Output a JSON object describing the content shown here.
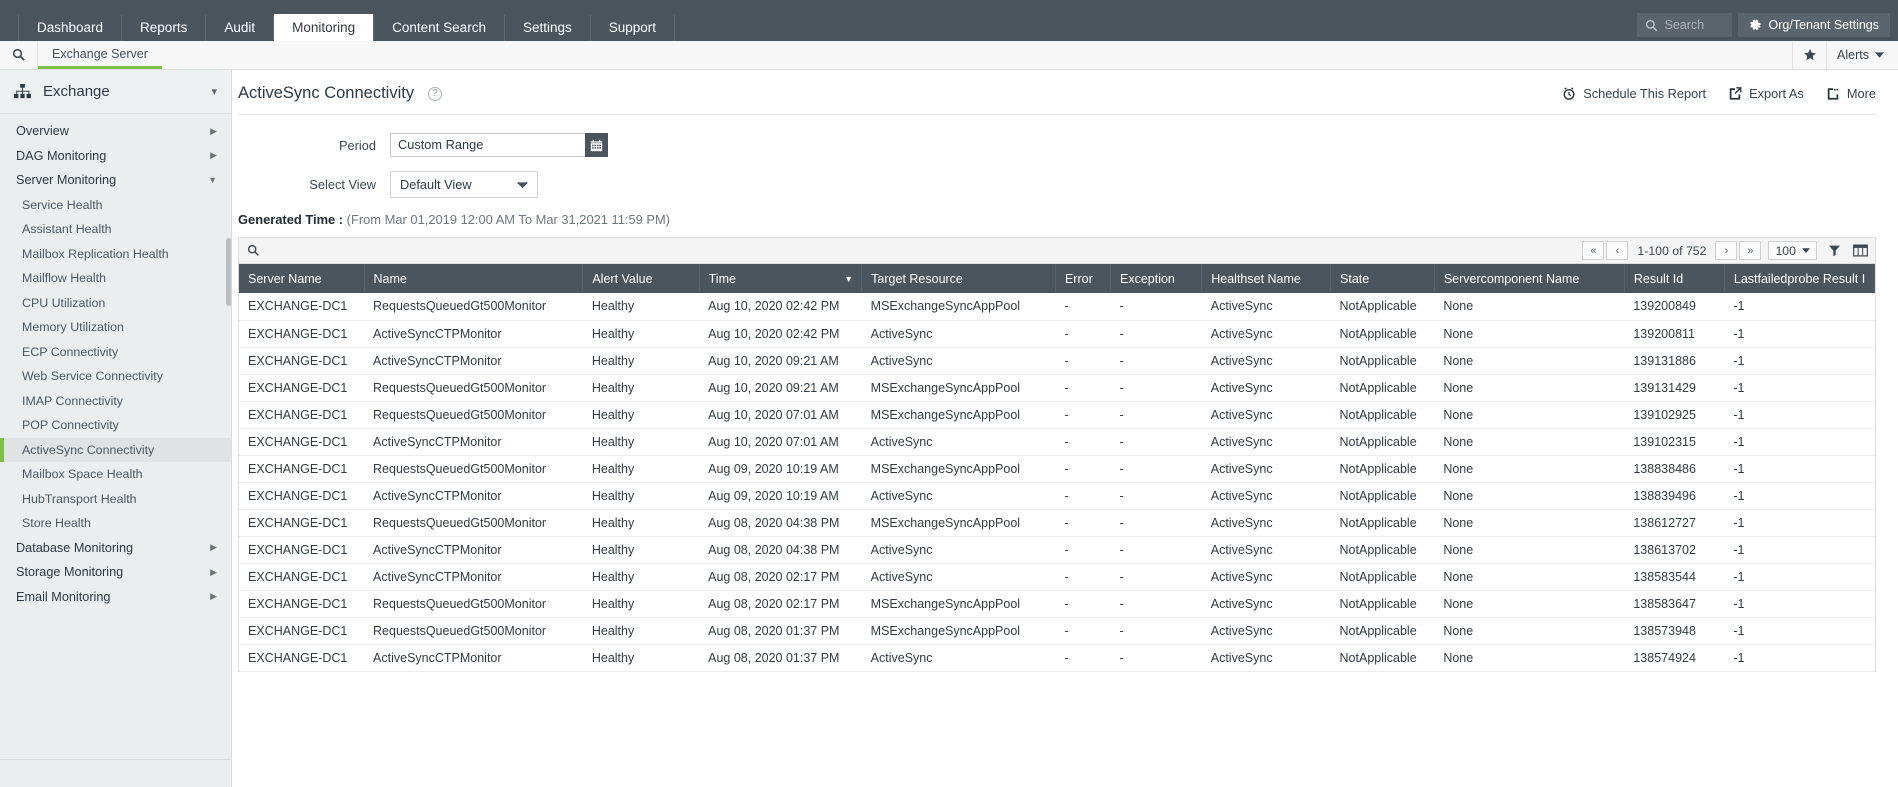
{
  "topnav": {
    "items": [
      {
        "label": "Dashboard",
        "active": false
      },
      {
        "label": "Reports",
        "active": false
      },
      {
        "label": "Audit",
        "active": false
      },
      {
        "label": "Monitoring",
        "active": true
      },
      {
        "label": "Content Search",
        "active": false
      },
      {
        "label": "Settings",
        "active": false
      },
      {
        "label": "Support",
        "active": false
      }
    ],
    "search_placeholder": "Search",
    "org_settings_label": "Org/Tenant Settings"
  },
  "subbar": {
    "tab_label": "Exchange Server",
    "alerts_label": "Alerts",
    "accent_color": "#7cc242"
  },
  "sidebar": {
    "header_title": "Exchange",
    "items": [
      {
        "label": "Overview",
        "level": 0,
        "caret": "▶",
        "selected": false
      },
      {
        "label": "DAG Monitoring",
        "level": 0,
        "caret": "▶",
        "selected": false
      },
      {
        "label": "Server Monitoring",
        "level": 0,
        "caret": "▼",
        "selected": false
      },
      {
        "label": "Service Health",
        "level": 1,
        "caret": "",
        "selected": false
      },
      {
        "label": "Assistant Health",
        "level": 1,
        "caret": "",
        "selected": false
      },
      {
        "label": "Mailbox Replication Health",
        "level": 1,
        "caret": "",
        "selected": false
      },
      {
        "label": "Mailflow Health",
        "level": 1,
        "caret": "",
        "selected": false
      },
      {
        "label": "CPU Utilization",
        "level": 1,
        "caret": "",
        "selected": false
      },
      {
        "label": "Memory Utilization",
        "level": 1,
        "caret": "",
        "selected": false
      },
      {
        "label": "ECP Connectivity",
        "level": 1,
        "caret": "",
        "selected": false
      },
      {
        "label": "Web Service Connectivity",
        "level": 1,
        "caret": "",
        "selected": false
      },
      {
        "label": "IMAP Connectivity",
        "level": 1,
        "caret": "",
        "selected": false
      },
      {
        "label": "POP Connectivity",
        "level": 1,
        "caret": "",
        "selected": false
      },
      {
        "label": "ActiveSync Connectivity",
        "level": 1,
        "caret": "",
        "selected": true
      },
      {
        "label": "Mailbox Space Health",
        "level": 1,
        "caret": "",
        "selected": false
      },
      {
        "label": "HubTransport Health",
        "level": 1,
        "caret": "",
        "selected": false
      },
      {
        "label": "Store Health",
        "level": 1,
        "caret": "",
        "selected": false
      },
      {
        "label": "Database Monitoring",
        "level": 0,
        "caret": "▶",
        "selected": false
      },
      {
        "label": "Storage Monitoring",
        "level": 0,
        "caret": "▶",
        "selected": false
      },
      {
        "label": "Email Monitoring",
        "level": 0,
        "caret": "▶",
        "selected": false
      }
    ]
  },
  "page": {
    "title": "ActiveSync Connectivity",
    "actions": [
      {
        "label": "Schedule This Report",
        "icon": "alarm-clock-icon"
      },
      {
        "label": "Export As",
        "icon": "export-icon"
      },
      {
        "label": "More",
        "icon": "more-icon"
      }
    ],
    "period_label": "Period",
    "period_value": "Custom Range",
    "select_view_label": "Select View",
    "select_view_value": "Default View",
    "generated_time_label": "Generated Time :",
    "generated_time_value": "(From Mar 01,2019 12:00 AM To Mar 31,2021 11:59 PM)"
  },
  "table": {
    "pagination": {
      "range": "1-100 of 752",
      "page_size": "100",
      "first": "«",
      "prev": "‹",
      "next": "›",
      "last": "»"
    },
    "columns": [
      {
        "key": "server_name",
        "label": "Server Name",
        "sorted": false
      },
      {
        "key": "name",
        "label": "Name",
        "sorted": false
      },
      {
        "key": "alert_value",
        "label": "Alert Value",
        "sorted": false
      },
      {
        "key": "time",
        "label": "Time",
        "sorted": true
      },
      {
        "key": "target_resource",
        "label": "Target Resource",
        "sorted": false
      },
      {
        "key": "error",
        "label": "Error",
        "sorted": false
      },
      {
        "key": "exception",
        "label": "Exception",
        "sorted": false
      },
      {
        "key": "healthset_name",
        "label": "Healthset Name",
        "sorted": false
      },
      {
        "key": "state",
        "label": "State",
        "sorted": false
      },
      {
        "key": "servercomponent_name",
        "label": "Servercomponent Name",
        "sorted": false
      },
      {
        "key": "result_id",
        "label": "Result Id",
        "sorted": false
      },
      {
        "key": "lastfailedprobe_result_id",
        "label": "Lastfailedprobe Result I",
        "sorted": false
      }
    ],
    "rows": [
      [
        "EXCHANGE-DC1",
        "RequestsQueuedGt500Monitor",
        "Healthy",
        "Aug 10, 2020 02:42 PM",
        "MSExchangeSyncAppPool",
        "-",
        "-",
        "ActiveSync",
        "NotApplicable",
        "None",
        "139200849",
        "-1"
      ],
      [
        "EXCHANGE-DC1",
        "ActiveSyncCTPMonitor",
        "Healthy",
        "Aug 10, 2020 02:42 PM",
        "ActiveSync",
        "-",
        "-",
        "ActiveSync",
        "NotApplicable",
        "None",
        "139200811",
        "-1"
      ],
      [
        "EXCHANGE-DC1",
        "ActiveSyncCTPMonitor",
        "Healthy",
        "Aug 10, 2020 09:21 AM",
        "ActiveSync",
        "-",
        "-",
        "ActiveSync",
        "NotApplicable",
        "None",
        "139131886",
        "-1"
      ],
      [
        "EXCHANGE-DC1",
        "RequestsQueuedGt500Monitor",
        "Healthy",
        "Aug 10, 2020 09:21 AM",
        "MSExchangeSyncAppPool",
        "-",
        "-",
        "ActiveSync",
        "NotApplicable",
        "None",
        "139131429",
        "-1"
      ],
      [
        "EXCHANGE-DC1",
        "RequestsQueuedGt500Monitor",
        "Healthy",
        "Aug 10, 2020 07:01 AM",
        "MSExchangeSyncAppPool",
        "-",
        "-",
        "ActiveSync",
        "NotApplicable",
        "None",
        "139102925",
        "-1"
      ],
      [
        "EXCHANGE-DC1",
        "ActiveSyncCTPMonitor",
        "Healthy",
        "Aug 10, 2020 07:01 AM",
        "ActiveSync",
        "-",
        "-",
        "ActiveSync",
        "NotApplicable",
        "None",
        "139102315",
        "-1"
      ],
      [
        "EXCHANGE-DC1",
        "RequestsQueuedGt500Monitor",
        "Healthy",
        "Aug 09, 2020 10:19 AM",
        "MSExchangeSyncAppPool",
        "-",
        "-",
        "ActiveSync",
        "NotApplicable",
        "None",
        "138838486",
        "-1"
      ],
      [
        "EXCHANGE-DC1",
        "ActiveSyncCTPMonitor",
        "Healthy",
        "Aug 09, 2020 10:19 AM",
        "ActiveSync",
        "-",
        "-",
        "ActiveSync",
        "NotApplicable",
        "None",
        "138839496",
        "-1"
      ],
      [
        "EXCHANGE-DC1",
        "RequestsQueuedGt500Monitor",
        "Healthy",
        "Aug 08, 2020 04:38 PM",
        "MSExchangeSyncAppPool",
        "-",
        "-",
        "ActiveSync",
        "NotApplicable",
        "None",
        "138612727",
        "-1"
      ],
      [
        "EXCHANGE-DC1",
        "ActiveSyncCTPMonitor",
        "Healthy",
        "Aug 08, 2020 04:38 PM",
        "ActiveSync",
        "-",
        "-",
        "ActiveSync",
        "NotApplicable",
        "None",
        "138613702",
        "-1"
      ],
      [
        "EXCHANGE-DC1",
        "ActiveSyncCTPMonitor",
        "Healthy",
        "Aug 08, 2020 02:17 PM",
        "ActiveSync",
        "-",
        "-",
        "ActiveSync",
        "NotApplicable",
        "None",
        "138583544",
        "-1"
      ],
      [
        "EXCHANGE-DC1",
        "RequestsQueuedGt500Monitor",
        "Healthy",
        "Aug 08, 2020 02:17 PM",
        "MSExchangeSyncAppPool",
        "-",
        "-",
        "ActiveSync",
        "NotApplicable",
        "None",
        "138583647",
        "-1"
      ],
      [
        "EXCHANGE-DC1",
        "RequestsQueuedGt500Monitor",
        "Healthy",
        "Aug 08, 2020 01:37 PM",
        "MSExchangeSyncAppPool",
        "-",
        "-",
        "ActiveSync",
        "NotApplicable",
        "None",
        "138573948",
        "-1"
      ],
      [
        "EXCHANGE-DC1",
        "ActiveSyncCTPMonitor",
        "Healthy",
        "Aug 08, 2020 01:37 PM",
        "ActiveSync",
        "-",
        "-",
        "ActiveSync",
        "NotApplicable",
        "None",
        "138574924",
        "-1"
      ]
    ]
  }
}
